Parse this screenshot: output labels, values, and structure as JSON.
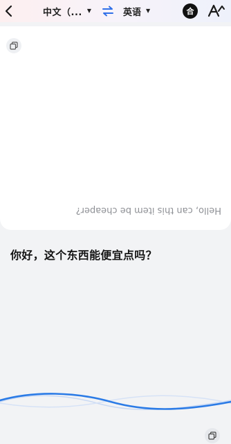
{
  "header": {
    "source_language": "中文（...",
    "target_language": "英语",
    "merge_label": "合",
    "back_icon": "chevron-left-icon",
    "swap_icon": "swap-arrows-icon",
    "font_icon": "font-size-icon"
  },
  "upper_panel": {
    "text_mirrored": "Hello, can this item be cheaper?",
    "copy_icon": "copy-icon"
  },
  "lower_panel": {
    "text": "你好，这个东西能便宜点吗？",
    "copy_icon": "copy-icon"
  },
  "colors": {
    "accent_blue": "#2f6fe8",
    "wave_blue": "#2b7be6",
    "background": "#f2f3f5",
    "card": "#ffffff"
  }
}
